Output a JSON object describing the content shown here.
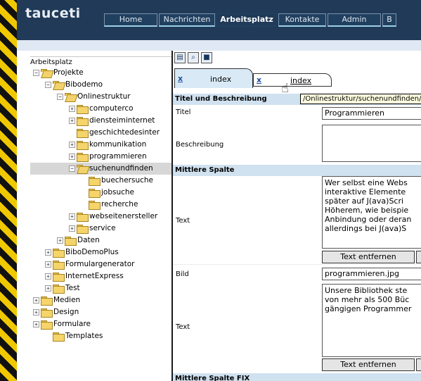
{
  "app": {
    "logo": "tauceti"
  },
  "nav": [
    {
      "label": "Home",
      "width": 76
    },
    {
      "label": "Nachrichten",
      "width": 80
    },
    {
      "label": "Arbeitsplatz",
      "width": 86
    },
    {
      "label": "Kontakte",
      "width": 68
    },
    {
      "label": "Admin",
      "width": 76
    },
    {
      "label": "B",
      "width": 20
    }
  ],
  "nav_active": "Arbeitsplatz",
  "tree": {
    "title": "Arbeitsplatz",
    "items": [
      {
        "label": "Projekte",
        "level": 0,
        "expander": "−",
        "open": true
      },
      {
        "label": "Bibodemo",
        "level": 1,
        "expander": "−",
        "open": true
      },
      {
        "label": "Onlinestruktur",
        "level": 2,
        "expander": "−",
        "open": true
      },
      {
        "label": "computerco",
        "level": 3,
        "expander": "+"
      },
      {
        "label": "diensteiminternet",
        "level": 3,
        "expander": "+"
      },
      {
        "label": "geschichtedesinter",
        "level": 3,
        "expander": ""
      },
      {
        "label": "kommunikation",
        "level": 3,
        "expander": "+"
      },
      {
        "label": "programmieren",
        "level": 3,
        "expander": "+"
      },
      {
        "label": "suchenundfinden",
        "level": 3,
        "expander": "−",
        "open": true,
        "selected": true
      },
      {
        "label": "buechersuche",
        "level": 4,
        "expander": ""
      },
      {
        "label": "jobsuche",
        "level": 4,
        "expander": ""
      },
      {
        "label": "recherche",
        "level": 4,
        "expander": ""
      },
      {
        "label": "webseitenersteller",
        "level": 3,
        "expander": "+"
      },
      {
        "label": "service",
        "level": 3,
        "expander": "+"
      },
      {
        "label": "Daten",
        "level": 2,
        "expander": "+"
      },
      {
        "label": "BiboDemoPlus",
        "level": 1,
        "expander": "+"
      },
      {
        "label": "Formulargenerator",
        "level": 1,
        "expander": "+"
      },
      {
        "label": "InternetExpress",
        "level": 1,
        "expander": "+"
      },
      {
        "label": "Test",
        "level": 1,
        "expander": "+"
      },
      {
        "label": "Medien",
        "level": 0,
        "expander": "+"
      },
      {
        "label": "Design",
        "level": 0,
        "expander": "+"
      },
      {
        "label": "Formulare",
        "level": 0,
        "expander": "+"
      },
      {
        "label": "Templates",
        "level": 1,
        "expander": ""
      }
    ]
  },
  "toolbar": {
    "icons": [
      "properties-icon",
      "preview-icon",
      "save-icon"
    ]
  },
  "tabs": [
    {
      "close": "x",
      "label": "index"
    },
    {
      "close": "x",
      "label": "index"
    }
  ],
  "tooltip": "/Onlinestruktur/suchenundfinden/b",
  "form": {
    "section1": "Titel und Beschreibung",
    "titel_label": "Titel",
    "titel_value": "Programmieren",
    "beschreibung_label": "Beschreibung",
    "beschreibung_value": "",
    "section2": "Mittlere Spalte",
    "text1_label": "Text",
    "text1_value": "Wer selbst eine Webs\ninteraktive Elemente \nspäter auf J(ava)Scri\nHöherem, wie beispie\nAnbindung oder deran\nallerdings bei J(ava)S",
    "remove1": "Text entfernen",
    "bild_label": "Bild",
    "bild_value": "programmieren.jpg",
    "text2_label": "Text",
    "text2_value": "Unsere Bibliothek ste\nvon mehr als 500 Büc\ngängigen Programmer",
    "remove2": "Text entfernen",
    "section3": "Mittlere Spalte FIX"
  }
}
